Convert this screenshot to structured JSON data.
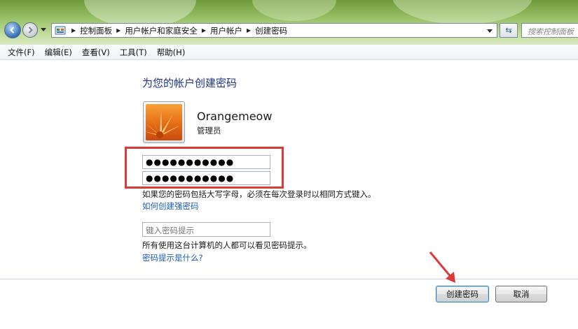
{
  "address_bar": {
    "breadcrumbs": [
      "控制面板",
      "用户帐户和家庭安全",
      "用户帐户",
      "创建密码"
    ],
    "search_placeholder": "搜索控制面板"
  },
  "menu": [
    "文件(F)",
    "编辑(E)",
    "查看(V)",
    "工具(T)",
    "帮助(H)"
  ],
  "page": {
    "heading": "为您的帐户创建密码",
    "user_name": "Orangemeow",
    "user_role": "管理员",
    "new_password_value": "●●●●●●●●●●●",
    "confirm_password_value": "●●●●●●●●●●●",
    "case_note": "如果您的密码包括大写字母，必须在每次登录时以相同方式键入。",
    "strong_password_link": "如何创建强密码",
    "hint_placeholder": "键入密码提示",
    "hint_visibility_note": "所有使用这台计算机的人都可以看见密码提示。",
    "hint_help_link": "密码提示是什么?"
  },
  "buttons": {
    "create": "创建密码",
    "cancel": "取消"
  },
  "annotation_colors": {
    "highlight_box": "#d93a3a",
    "arrow": "#d93a3a"
  }
}
